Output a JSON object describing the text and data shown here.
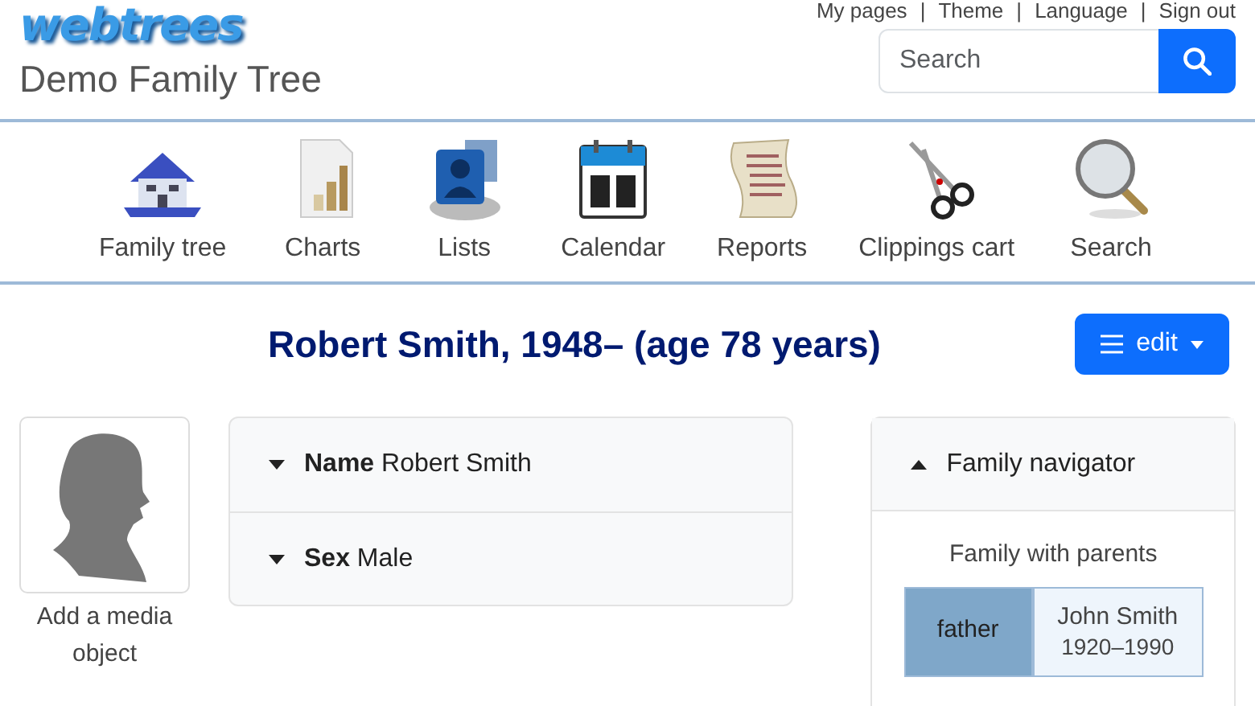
{
  "header": {
    "logo": "webtrees",
    "top_menu": [
      "My pages",
      "Theme",
      "Language",
      "Sign out"
    ],
    "separator": "|",
    "tree_title": "Demo Family Tree",
    "search": {
      "placeholder": "Search"
    }
  },
  "main_menu": [
    {
      "label": "Family tree",
      "kind": "house"
    },
    {
      "label": "Charts",
      "kind": "chart"
    },
    {
      "label": "Lists",
      "kind": "lists"
    },
    {
      "label": "Calendar",
      "kind": "calendar"
    },
    {
      "label": "Reports",
      "kind": "scroll"
    },
    {
      "label": "Clippings cart",
      "kind": "scissors"
    },
    {
      "label": "Search",
      "kind": "magnifier"
    }
  ],
  "page_title": "Robert Smith, 1948– (age 78 years)",
  "edit_button": {
    "label": "edit"
  },
  "media": {
    "caption": "Add a media object"
  },
  "facts": [
    {
      "label": "Name",
      "value": "Robert Smith",
      "expanded": false
    },
    {
      "label": "Sex",
      "value": "Male",
      "expanded": false
    }
  ],
  "sidebar": {
    "title": "Family navigator",
    "expanded": true,
    "family": {
      "title": "Family with parents",
      "members": [
        {
          "role": "father",
          "name": "John Smith",
          "dates": "1920–1990"
        }
      ]
    }
  }
}
